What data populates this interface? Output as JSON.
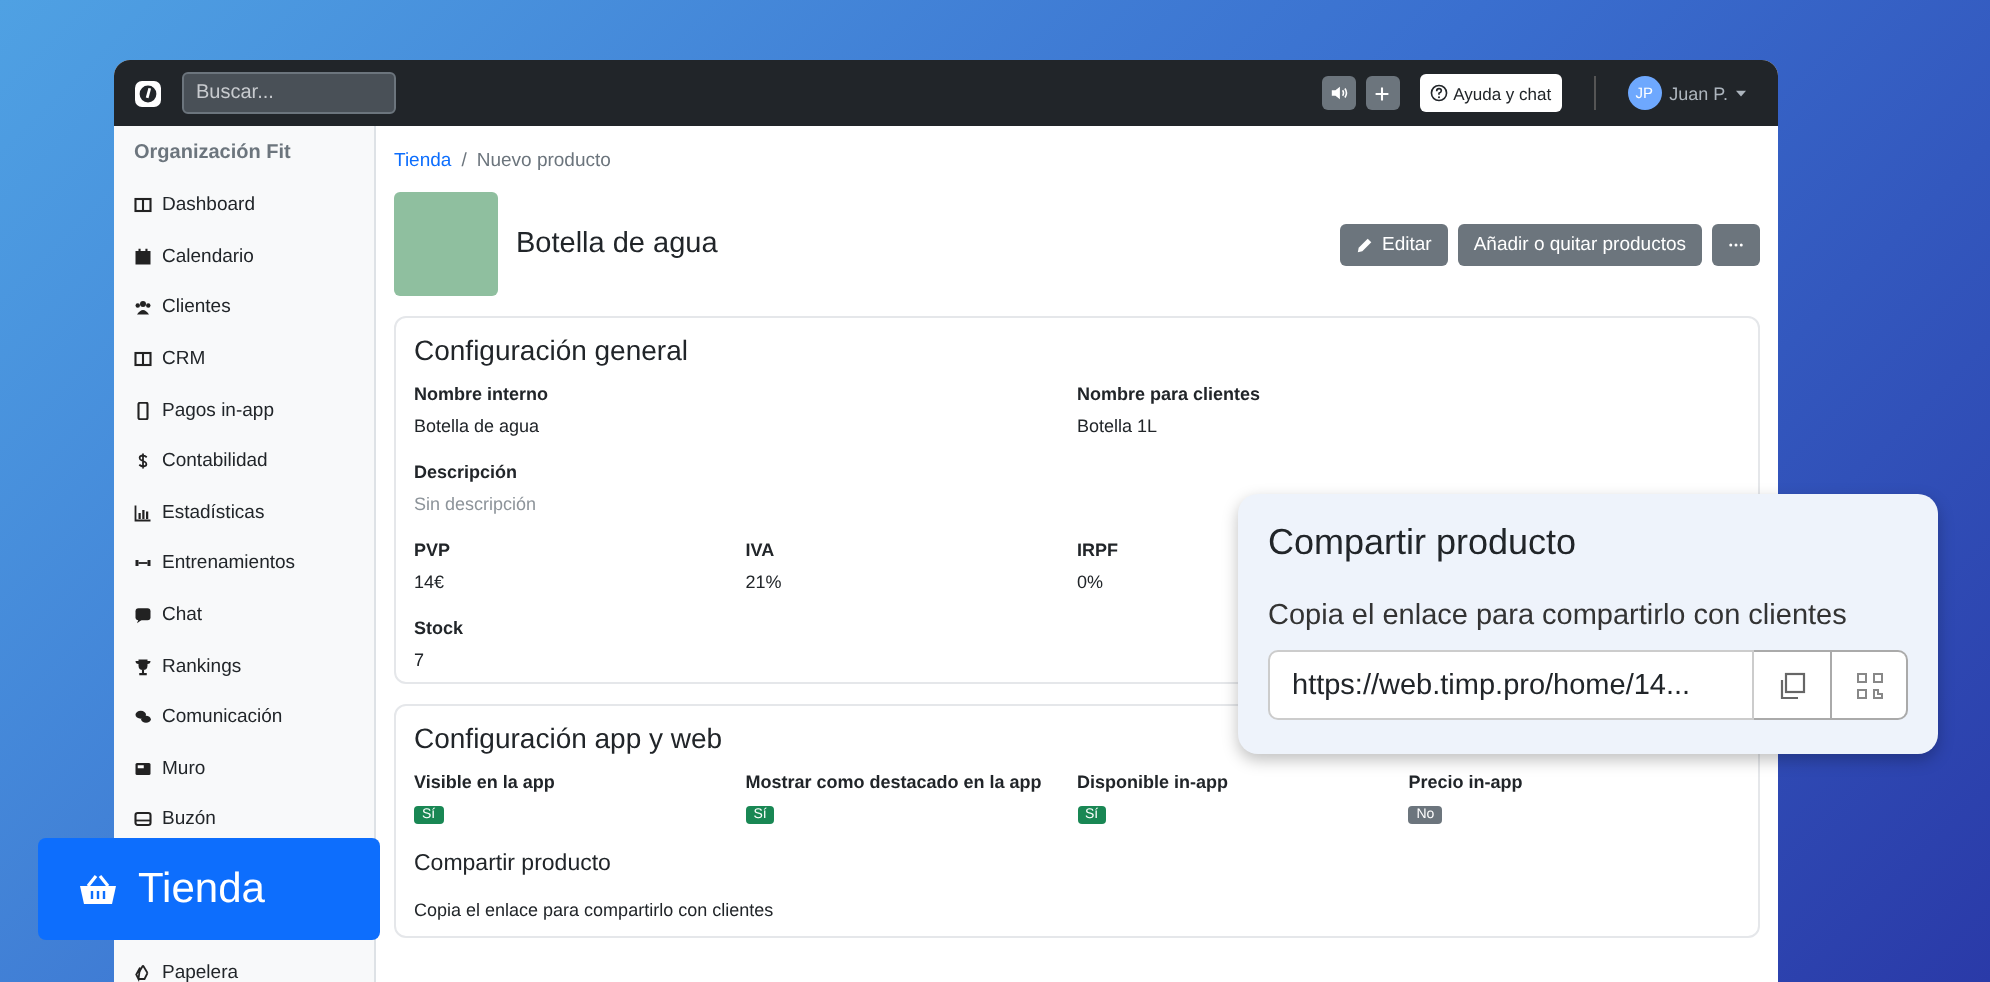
{
  "topbar": {
    "search": {
      "placeholder": "Buscar..."
    },
    "help_button": "Ayuda y chat",
    "user": {
      "initials": "JP",
      "name": "Juan P."
    }
  },
  "sidebar": {
    "organization": "Organización Fit",
    "items": [
      {
        "label": "Dashboard"
      },
      {
        "label": "Calendario"
      },
      {
        "label": "Clientes"
      },
      {
        "label": "CRM"
      },
      {
        "label": "Pagos in-app"
      },
      {
        "label": "Contabilidad"
      },
      {
        "label": "Estadísticas"
      },
      {
        "label": "Entrenamientos"
      },
      {
        "label": "Chat"
      },
      {
        "label": "Rankings"
      },
      {
        "label": "Comunicación"
      },
      {
        "label": "Muro"
      },
      {
        "label": "Buzón"
      }
    ],
    "items_below": [
      {
        "label": "Papelera"
      }
    ]
  },
  "callout": {
    "label": "Tienda"
  },
  "breadcrumb": {
    "link": "Tienda",
    "separator": "/",
    "current": "Nuevo producto"
  },
  "product": {
    "title": "Botella de agua",
    "buttons": {
      "edit": "Editar",
      "add_remove": "Añadir o quitar productos"
    }
  },
  "general": {
    "heading": "Configuración general",
    "rows": [
      [
        {
          "label": "Nombre interno",
          "value": "Botella de agua",
          "empty": false
        },
        null,
        {
          "label": "Nombre para clientes",
          "value": "Botella 1L",
          "empty": false
        }
      ],
      [
        {
          "label": "Descripción",
          "value": "Sin descripción",
          "empty": true
        }
      ],
      [
        {
          "label": "PVP",
          "value": "14€",
          "empty": false
        },
        {
          "label": "IVA",
          "value": "21%",
          "empty": false
        },
        {
          "label": "IRPF",
          "value": "0%",
          "empty": false
        }
      ],
      [
        {
          "label": "Stock",
          "value": "7",
          "empty": false
        }
      ]
    ]
  },
  "app_web": {
    "heading": "Configuración app y web",
    "flags": [
      {
        "label": "Visible en la app",
        "value": "Sí",
        "on": true
      },
      {
        "label": "Mostrar como destacado en la app",
        "value": "Sí",
        "on": true
      },
      {
        "label": "Disponible in-app",
        "value": "Sí",
        "on": true
      },
      {
        "label": "Precio in-app",
        "value": "No",
        "on": false
      }
    ],
    "share_heading": "Compartir producto",
    "share_text": "Copia el enlace para compartirlo con clientes"
  },
  "share_popup": {
    "title": "Compartir producto",
    "text": "Copia el enlace para compartirlo con clientes",
    "url": "https://web.timp.pro/home/14..."
  }
}
